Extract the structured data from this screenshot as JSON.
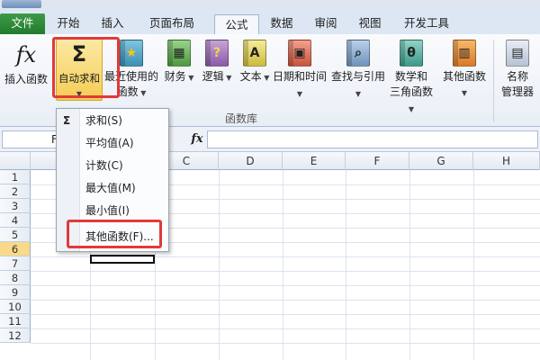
{
  "tabs": [
    "文件",
    "开始",
    "插入",
    "页面布局",
    "公式",
    "数据",
    "审阅",
    "视图",
    "开发工具"
  ],
  "active_tab": "公式",
  "ribbon": {
    "insert_function": "插入函数",
    "autosum": "自动求和",
    "recent_1": "最近使用的",
    "recent_2": "函数",
    "financial": "财务",
    "logical": "逻辑",
    "text": "文本",
    "datetime": "日期和时间",
    "lookup": "查找与引用",
    "math_1": "数学和",
    "math_2": "三角函数",
    "more": "其他函数",
    "name_1": "名称",
    "name_2": "管理器",
    "group_label": "函数库"
  },
  "formula_bar": {
    "namebox_value": "F",
    "fx_label": "fx",
    "formula_value": ""
  },
  "columns": [
    "C",
    "D",
    "E",
    "F",
    "G",
    "H"
  ],
  "rows": [
    "1",
    "2",
    "3",
    "4",
    "5",
    "6",
    "7",
    "8",
    "9",
    "10",
    "11",
    "12"
  ],
  "selected_row": "6",
  "dropdown": {
    "items": [
      "求和(S)",
      "平均值(A)",
      "计数(C)",
      "最大值(M)",
      "最小值(I)",
      "其他函数(F)..."
    ]
  },
  "colors": {
    "file_tab": "#2e8b3a",
    "highlight": "#e03a3a",
    "autosum_bg": "#f5cd55"
  }
}
